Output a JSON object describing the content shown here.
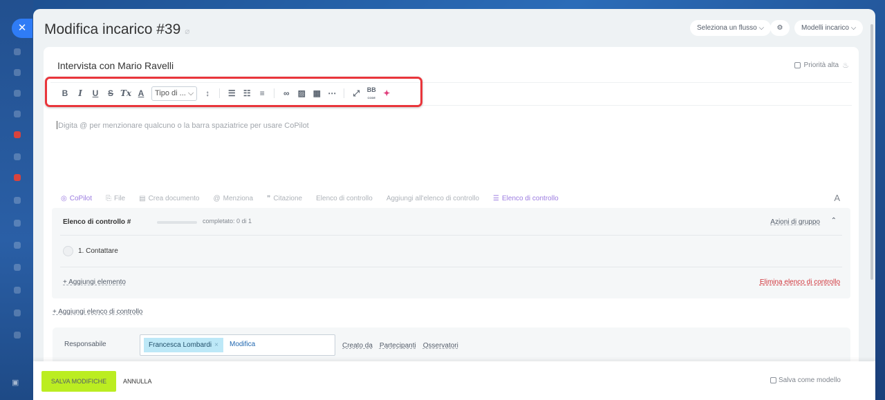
{
  "header": {
    "title": "Modifica incarico #39",
    "flow_select": "Seleziona un flusso",
    "templates_label": "Modelli incarico"
  },
  "task": {
    "title": "Intervista con Mario Ravelli",
    "priority_label": "Priorità alta"
  },
  "toolbar": {
    "items": [
      "B",
      "I",
      "U",
      "S",
      "Tx",
      "A"
    ],
    "font_type_select": "Tipo di ...",
    "bb_label": "BB",
    "bb_sub": "CODE"
  },
  "editor": {
    "placeholder": "Digita @ per menzionare qualcuno o la barra spaziatrice per usare CoPilot"
  },
  "actions": {
    "copilot": "CoPilot",
    "file": "File",
    "create_document": "Crea documento",
    "mention": "Menziona",
    "quote": "Citazione",
    "checklist": "Elenco di controllo",
    "add_to_checklist": "Aggiungi all'elenco di controllo",
    "checklist_active": "Elenco di controllo",
    "font_toggle": "A"
  },
  "checklist": {
    "title": "Elenco di controllo #",
    "progress_fraction": 0,
    "status": "completato: 0 di 1",
    "group_actions": "Azioni di gruppo",
    "items": [
      {
        "label": "1. Contattare"
      }
    ],
    "add_item": "+ Aggiungi elemento",
    "delete": "Elimina elenco di controllo"
  },
  "add_checklist": "+ Aggiungi elenco di controllo",
  "responsible": {
    "label": "Responsabile",
    "person": "Francesca Lombardi",
    "change": "Modifica",
    "created_by": "Creato da",
    "participants": "Partecipanti",
    "observers": "Osservatori"
  },
  "footer": {
    "save": "SALVA MODIFICHE",
    "cancel": "ANNULLA",
    "save_as_template": "Salva come modello"
  },
  "colors": {
    "accent": "#2f7cf6",
    "save_button": "#bbed21",
    "highlight_frame": "#e9353b",
    "danger": "#d0343a"
  }
}
